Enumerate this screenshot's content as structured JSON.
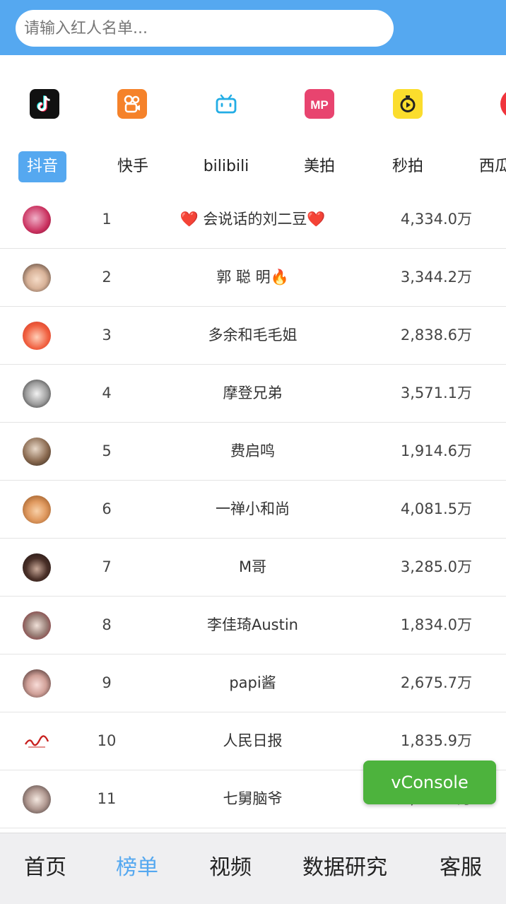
{
  "search": {
    "placeholder": "请输入红人名单...",
    "value": ""
  },
  "platform_icons": [
    {
      "name": "douyin-icon",
      "color": "#111111"
    },
    {
      "name": "kuaishou-icon",
      "color": "#f5822a"
    },
    {
      "name": "bilibili-icon",
      "color": "#23ade5"
    },
    {
      "name": "meipai-icon",
      "color": "#e8446f"
    },
    {
      "name": "miaopai-icon",
      "color": "#fbdd2d"
    },
    {
      "name": "xigua-icon",
      "color": "#f0343c"
    }
  ],
  "tabs": [
    "抖音",
    "快手",
    "bilibili",
    "美拍",
    "秒拍",
    "西瓜"
  ],
  "active_tab": "抖音",
  "rank_list": [
    {
      "rank": "1",
      "name": "❤️ 会说话的刘二豆❤️",
      "fans": "4,334.0万"
    },
    {
      "rank": "2",
      "name": "郭 聪 明🔥",
      "fans": "3,344.2万"
    },
    {
      "rank": "3",
      "name": "多余和毛毛姐",
      "fans": "2,838.6万"
    },
    {
      "rank": "4",
      "name": "摩登兄弟",
      "fans": "3,571.1万"
    },
    {
      "rank": "5",
      "name": "费启鸣",
      "fans": "1,914.6万"
    },
    {
      "rank": "6",
      "name": "一禅小和尚",
      "fans": "4,081.5万"
    },
    {
      "rank": "7",
      "name": "M哥",
      "fans": "3,285.0万"
    },
    {
      "rank": "8",
      "name": "李佳琦Austin",
      "fans": "1,834.0万"
    },
    {
      "rank": "9",
      "name": "papi酱",
      "fans": "2,675.7万"
    },
    {
      "rank": "10",
      "name": "人民日报",
      "fans": "1,835.9万"
    },
    {
      "rank": "11",
      "name": "七舅脑爷",
      "fans": "2,754.5万"
    }
  ],
  "vconsole_label": "vConsole",
  "bottom_nav": [
    "首页",
    "榜单",
    "视频",
    "数据研究",
    "客服"
  ],
  "bottom_nav_active": "榜单",
  "colors": {
    "accent": "#55a8f0",
    "vconsole": "#4db33d"
  }
}
